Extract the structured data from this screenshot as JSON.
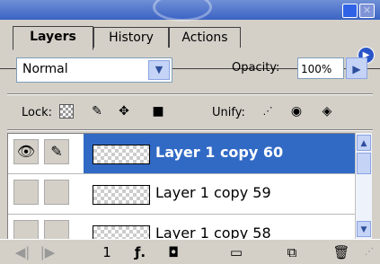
{
  "tabs": [
    "Layers",
    "History",
    "Actions"
  ],
  "blend_mode": "Normal",
  "opacity": {
    "label": "Opacity:",
    "value": "100%"
  },
  "lock_label": "Lock:",
  "unify_label": "Unify:",
  "layers": [
    {
      "name": "Layer 1 copy 60",
      "selected": true,
      "visible": true,
      "linked": true
    },
    {
      "name": "Layer 1 copy 59",
      "selected": false,
      "visible": false,
      "linked": false
    },
    {
      "name": "Layer 1 copy 58",
      "selected": false,
      "visible": false,
      "linked": false
    }
  ],
  "bottom": {
    "frame_number": "1"
  },
  "icons": {
    "menu": "menu-arrow-icon",
    "lock_transparent": "transparency-lock-icon",
    "lock_paint": "brush-lock-icon",
    "lock_move": "move-lock-icon",
    "lock_all": "lock-all-icon",
    "unify": [
      "unify-position-icon",
      "unify-visibility-icon",
      "unify-style-icon"
    ]
  }
}
